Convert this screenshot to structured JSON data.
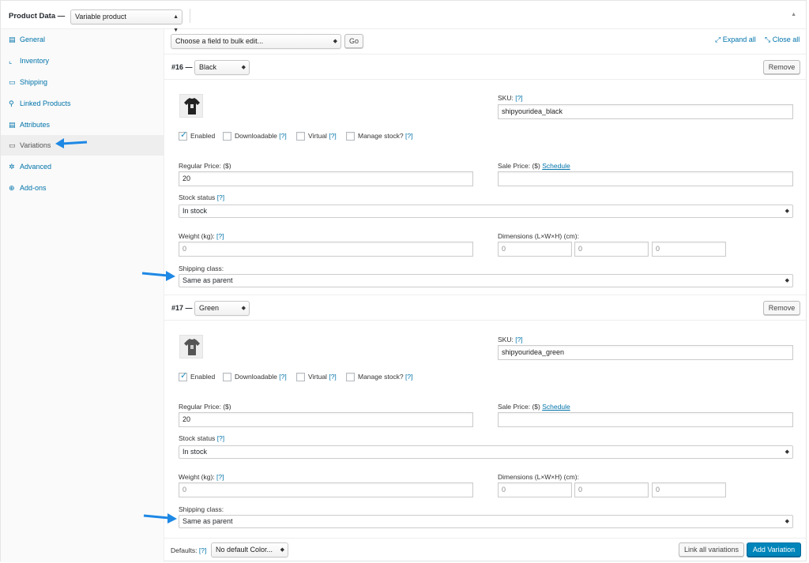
{
  "header": {
    "title": "Product Data —",
    "product_type": "Variable product"
  },
  "sidebar": {
    "items": [
      {
        "label": "General",
        "icon": "general-icon"
      },
      {
        "label": "Inventory",
        "icon": "inventory-icon"
      },
      {
        "label": "Shipping",
        "icon": "shipping-icon"
      },
      {
        "label": "Linked Products",
        "icon": "link-icon"
      },
      {
        "label": "Attributes",
        "icon": "list-icon"
      },
      {
        "label": "Variations",
        "icon": "grid-icon"
      },
      {
        "label": "Advanced",
        "icon": "gear-icon"
      },
      {
        "label": "Add-ons",
        "icon": "plus-circle-icon"
      }
    ]
  },
  "toolbar": {
    "bulk_edit": "Choose a field to bulk edit...",
    "go": "Go",
    "expand_all": "Expand all",
    "close_all": "Close all"
  },
  "variations": [
    {
      "number": "#16 —",
      "attribute": "Black",
      "remove": "Remove",
      "sku_label": "SKU:",
      "help": "[?]",
      "sku": "shipyouridea_black",
      "enabled": "Enabled",
      "downloadable": "Downloadable",
      "virtual": "Virtual",
      "manage_stock": "Manage stock?",
      "regular_price_label": "Regular Price: ($)",
      "regular_price": "20",
      "sale_price_label": "Sale Price: ($)",
      "schedule": "Schedule",
      "stock_status_label": "Stock status",
      "stock_status": "In stock",
      "weight_label": "Weight (kg):",
      "weight_placeholder": "0",
      "dimensions_label": "Dimensions (L×W×H) (cm):",
      "dim_l": "0",
      "dim_w": "0",
      "dim_h": "0",
      "shipping_class_label": "Shipping class:",
      "shipping_class": "Same as parent"
    },
    {
      "number": "#17 —",
      "attribute": "Green",
      "remove": "Remove",
      "sku_label": "SKU:",
      "help": "[?]",
      "sku": "shipyouridea_green",
      "enabled": "Enabled",
      "downloadable": "Downloadable",
      "virtual": "Virtual",
      "manage_stock": "Manage stock?",
      "regular_price_label": "Regular Price: ($)",
      "regular_price": "20",
      "sale_price_label": "Sale Price: ($)",
      "schedule": "Schedule",
      "stock_status_label": "Stock status",
      "stock_status": "In stock",
      "weight_label": "Weight (kg):",
      "weight_placeholder": "0",
      "dimensions_label": "Dimensions (L×W×H) (cm):",
      "dim_l": "0",
      "dim_w": "0",
      "dim_h": "0",
      "shipping_class_label": "Shipping class:",
      "shipping_class": "Same as parent"
    }
  ],
  "footer": {
    "defaults_label": "Defaults:",
    "help": "[?]",
    "default_color": "No default Color...",
    "link_all": "Link all variations",
    "add_variation": "Add Variation"
  },
  "colors": {
    "accent": "#0073aa",
    "primary_button": "#0085ba",
    "annotation_arrow": "#1e88e5"
  }
}
